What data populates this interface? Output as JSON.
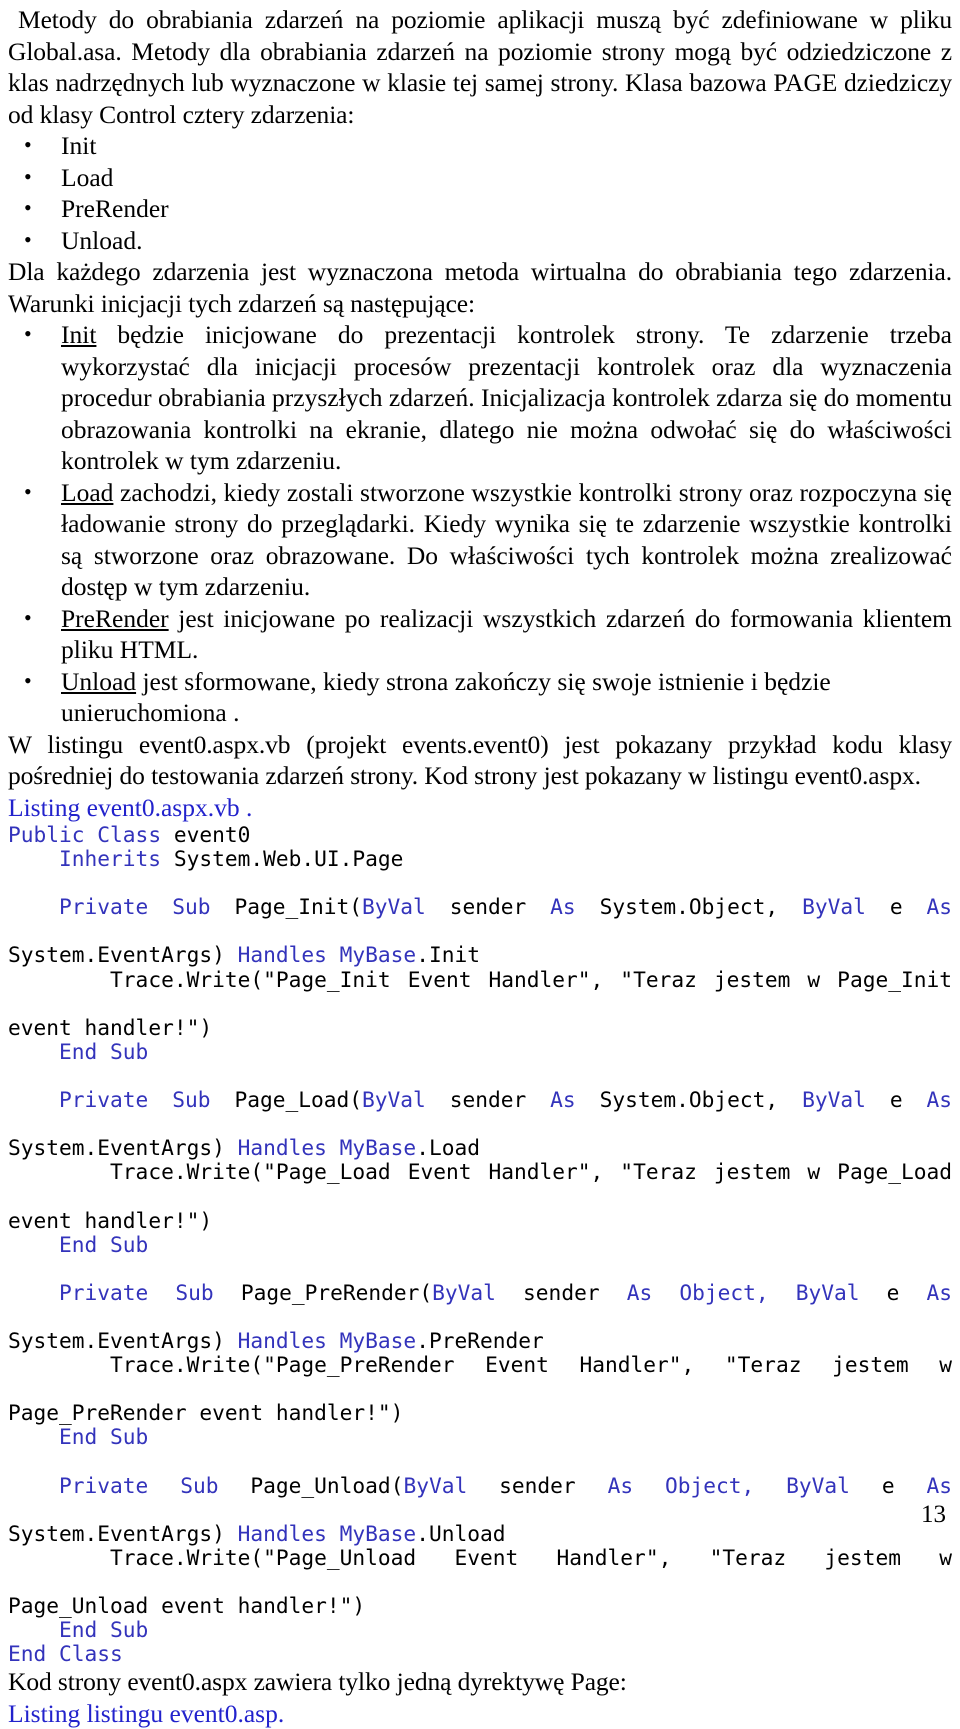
{
  "document": {
    "page_number": "13",
    "colors": {
      "body_text": "#000000",
      "listing_caption": "#2222cc",
      "code_keyword": "#3333bb"
    }
  },
  "paragraphs": {
    "p1": "Metody do obrabiania zdarzeń na poziomie aplikacji muszą być zdefiniowane w pliku Global.asa. Metody dla obrabiania zdarzeń na poziomie strony mogą być odziedziczone z klas nadrzędnych lub wyznaczone w klasie tej samej strony. Klasa bazowa PAGE dziedziczy  od klasy Control cztery zdarzenia:",
    "p2": "Dla każdego zdarzenia jest wyznaczona metoda wirtualna do obrabiania tego zdarzenia. Warunki inicjacji tych zdarzeń są następujące:",
    "p3_line1": "W listingu event0.aspx.vb (projekt events.event0)  jest pokazany przykład kodu klasy",
    "p3_line2": "pośredniej do testowania zdarzeń strony. Kod strony jest pokazany w listingu event0.aspx.",
    "p4": "Kod strony event0.aspx zawiera tylko jedną dyrektywę Page:"
  },
  "event_list": {
    "items": [
      "Init",
      "Load",
      "PreRender",
      "Unload."
    ]
  },
  "event_descriptions": [
    {
      "term": "Init",
      "rest": " będzie inicjowane do prezentacji kontrolek strony. Te zdarzenie trzeba wykorzystać dla inicjacji procesów prezentacji kontrolek oraz dla wyznaczenia  procedur obrabiania przyszłych zdarzeń. Inicjalizacja kontrolek zdarza  się do momentu obrazowania kontrolki na ekranie, dlatego nie można odwołać się do właściwości kontrolek w tym zdarzeniu."
    },
    {
      "term": "Load",
      "rest": " zachodzi, kiedy zostali stworzone wszystkie kontrolki strony oraz rozpoczyna się ładowanie strony do przeglądarki. Kiedy wynika się te zdarzenie  wszystkie kontrolki są stworzone oraz obrazowane. Do właściwości tych kontrolek można zrealizować dostęp w tym zdarzeniu."
    },
    {
      "term": "PreRender",
      "rest": " jest inicjowane po realizacji wszystkich zdarzeń do formowania klientem pliku HTML."
    },
    {
      "term": "Unload",
      "rest": "  jest sformowane,     kiedy strona zakończy się swoje istnienie i będzie unieruchomiona ."
    }
  ],
  "listings": {
    "caption_vb": "Listing event0.aspx.vb .",
    "caption_asp": "Listing listingu event0.asp."
  },
  "code": {
    "l01_kw": "Public Class",
    "l01_rest": " event0",
    "l02_kw": "Inherits",
    "l02_rest": " System.Web.UI.Page",
    "init_sig_kw1": "Private  Sub",
    "init_sig_name": "  Page_Init(",
    "init_sig_kw2": "ByVal",
    "init_sig_sender": "  sender",
    "init_sig_kw3": "As",
    "init_sig_type": "  System.Object,",
    "init_sig_kw4": "ByVal",
    "init_sig_e": "  e",
    "init_sig_kw5": "As",
    "init_cont_plain": "System.EventArgs) ",
    "init_cont_kw": "Handles MyBase",
    "init_cont_tail": ".Init",
    "init_trace": "Trace.Write(\"Page_Init Event Handler\", \"Teraz jestem w Page_Init",
    "init_trace2": "event handler!\")",
    "end_sub": "End Sub",
    "load_sig_name": "  Page_Load(",
    "load_sig_type": "  System.Object,",
    "load_cont_plain": "System.EventArgs) ",
    "load_cont_kw": "Handles MyBase",
    "load_cont_tail": ".Load",
    "load_trace": "Trace.Write(\"Page_Load Event Handler\", \"Teraz jestem w Page_Load",
    "load_trace2": "event handler!\")",
    "prerender_sig_name": "  Page_PreRender(",
    "prerender_sig_type_kw": "Object,",
    "prerender_cont_plain": "System.EventArgs) ",
    "prerender_cont_kw": "Handles MyBase",
    "prerender_cont_tail": ".PreRender",
    "prerender_trace": "Trace.Write(\"Page_PreRender  Event  Handler\",  \"Teraz  jestem  w",
    "prerender_trace2": "Page_PreRender event handler!\")",
    "unload_sig_name": "  Page_Unload(",
    "unload_sig_type_kw": "Object,",
    "unload_cont_plain": "System.EventArgs) ",
    "unload_cont_kw": "Handles MyBase",
    "unload_cont_tail": ".Unload",
    "unload_trace": "Trace.Write(\"Page_Unload  Event  Handler\",  \"Teraz  jestem  w",
    "unload_trace2": "Page_Unload event handler!\")",
    "end_class": "End Class",
    "kw_private": "Private",
    "kw_sub": "Sub",
    "kw_byval": "ByVal",
    "kw_as": "As",
    "txt_sender": "sender",
    "txt_e": "e"
  }
}
